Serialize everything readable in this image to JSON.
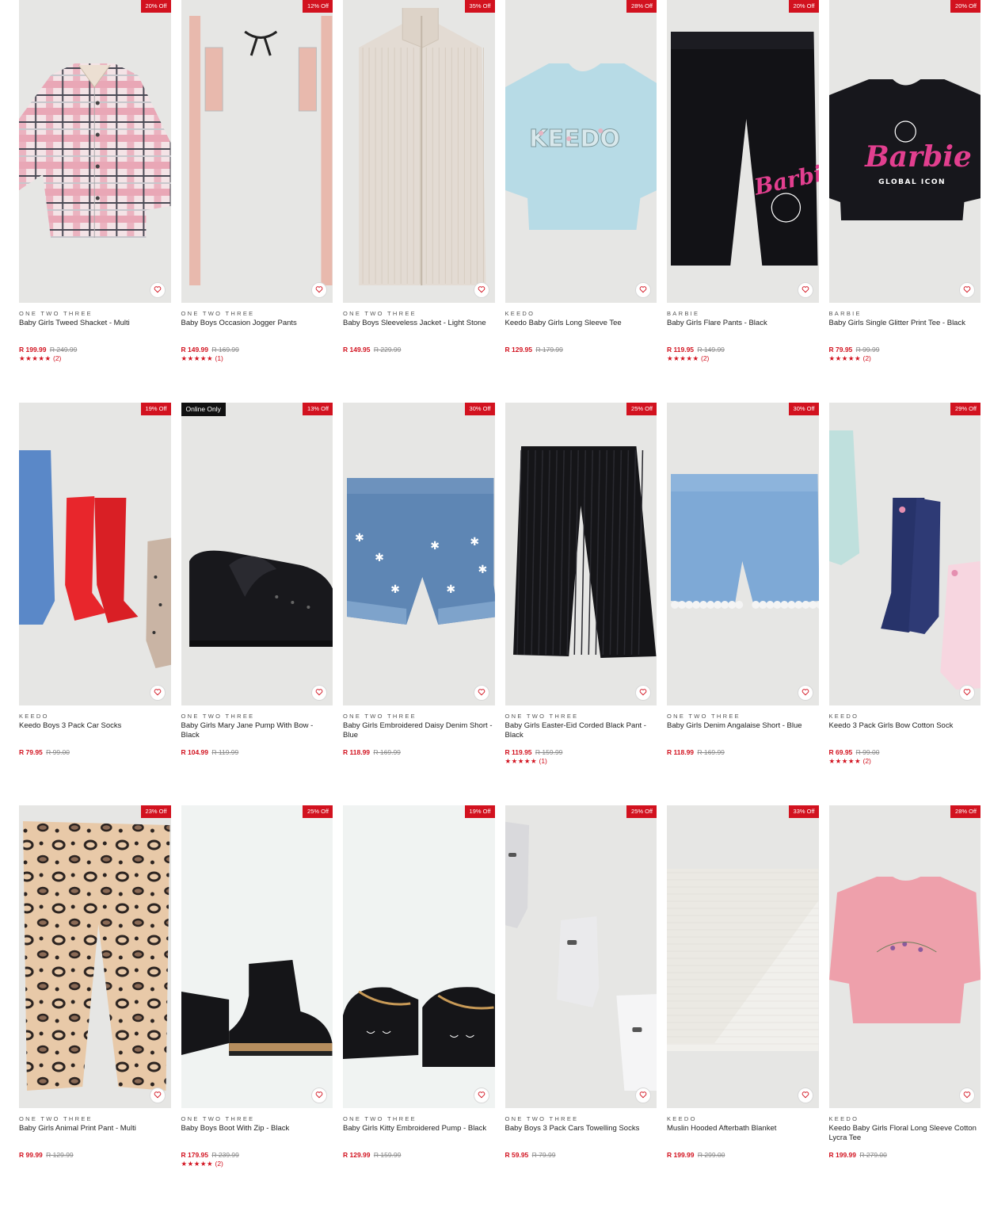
{
  "products": [
    {
      "brand": "ONE TWO THREE",
      "title": "Baby Girls Tweed Shacket - Multi",
      "price": "R 199.99",
      "was": "R 249.99",
      "discount": "20% Off",
      "rating": "(2)",
      "stars": "★★★★★",
      "img": "shacket"
    },
    {
      "brand": "ONE TWO THREE",
      "title": "Baby Boys Occasion Jogger Pants",
      "price": "R 149.99",
      "was": "R 169.99",
      "discount": "12% Off",
      "rating": "(1)",
      "stars": "★★★★★",
      "img": "jogger"
    },
    {
      "brand": "ONE TWO THREE",
      "title": "Baby Boys Sleeveless Jacket - Light Stone",
      "price": "R 149.95",
      "was": "R 229.99",
      "discount": "35% Off",
      "img": "vest"
    },
    {
      "brand": "KEEDO",
      "title": "Keedo Baby Girls Long Sleeve Tee",
      "price": "R 129.95",
      "was": "R 179.99",
      "discount": "28% Off",
      "img": "bluetee"
    },
    {
      "brand": "BARBIE",
      "title": "Baby Girls Flare Pants - Black",
      "price": "R 119.95",
      "was": "R 149.99",
      "discount": "20% Off",
      "rating": "(2)",
      "stars": "★★★★★",
      "img": "barbiepants"
    },
    {
      "brand": "BARBIE",
      "title": "Baby Girls Single Glitter Print Tee - Black",
      "price": "R 79.95",
      "was": "R 99.99",
      "discount": "20% Off",
      "rating": "(2)",
      "stars": "★★★★★",
      "img": "barbietee"
    },
    {
      "brand": "KEEDO",
      "title": "Keedo Boys 3 Pack Car Socks",
      "price": "R 79.95",
      "was": "R 99.00",
      "discount": "19% Off",
      "img": "carsocks"
    },
    {
      "brand": "ONE TWO THREE",
      "title": "Baby Girls Mary Jane Pump With Bow - Black",
      "price": "R 104.99",
      "was": "R 119.99",
      "discount": "13% Off",
      "online": "Online Only",
      "img": "maryjane"
    },
    {
      "brand": "ONE TWO THREE",
      "title": "Baby Girls Embroidered Daisy Denim Short - Blue",
      "price": "R 118.99",
      "was": "R 169.99",
      "discount": "30% Off",
      "img": "denim1"
    },
    {
      "brand": "ONE TWO THREE",
      "title": "Baby Girls Easter-Eid Corded Black Pant - Black",
      "price": "R 119.95",
      "was": "R 159.99",
      "discount": "25% Off",
      "rating": "(1)",
      "stars": "★★★★★",
      "img": "blackpant"
    },
    {
      "brand": "ONE TWO THREE",
      "title": "Baby Girls Denim Angalaise Short - Blue",
      "price": "R 118.99",
      "was": "R 169.99",
      "discount": "30% Off",
      "img": "denim2"
    },
    {
      "brand": "KEEDO",
      "title": "Keedo 3 Pack Girls Bow Cotton Sock",
      "price": "R 69.95",
      "was": "R 99.00",
      "discount": "29% Off",
      "rating": "(2)",
      "stars": "★★★★★",
      "img": "bowsocks"
    },
    {
      "brand": "ONE TWO THREE",
      "title": "Baby Girls Animal Print Pant - Multi",
      "price": "R 99.99",
      "was": "R 129.99",
      "discount": "23% Off",
      "img": "leopard"
    },
    {
      "brand": "ONE TWO THREE",
      "title": "Baby Boys Boot With Zip - Black",
      "price": "R 179.95",
      "was": "R 239.99",
      "discount": "25% Off",
      "rating": "(2)",
      "stars": "★★★★★",
      "img": "boot"
    },
    {
      "brand": "ONE TWO THREE",
      "title": "Baby Girls Kitty Embroidered Pump - Black",
      "price": "R 129.99",
      "was": "R 159.99",
      "discount": "19% Off",
      "img": "kitty"
    },
    {
      "brand": "ONE TWO THREE",
      "title": "Baby Boys 3 Pack Cars Towelling Socks",
      "price": "R 59.95",
      "was": "R 79.99",
      "discount": "25% Off",
      "img": "towelsocks"
    },
    {
      "brand": "KEEDO",
      "title": "Muslin Hooded Afterbath Blanket",
      "price": "R 199.99",
      "was": "R 299.00",
      "discount": "33% Off",
      "img": "blanket"
    },
    {
      "brand": "KEEDO",
      "title": "Keedo Baby Girls Floral Long Sleeve Cotton Lycra Tee",
      "price": "R 199.99",
      "was": "R 279.00",
      "discount": "28% Off",
      "img": "pinktee"
    }
  ],
  "icons": {
    "wishlist": "heart-icon"
  },
  "colors": {
    "accent": "#d2121f",
    "image_bg": "#e6e6e4"
  }
}
